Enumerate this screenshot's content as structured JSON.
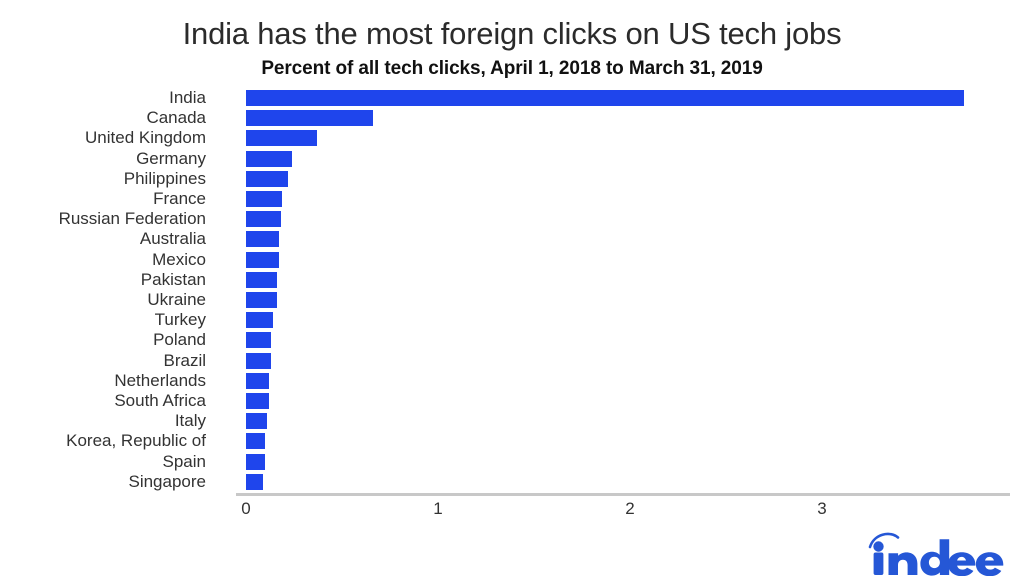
{
  "chart_data": {
    "type": "bar",
    "orientation": "horizontal",
    "title": "India has the most foreign clicks on US tech jobs",
    "subtitle": "Percent of all tech clicks, April 1, 2018 to March 31, 2019",
    "xlabel": "",
    "ylabel": "",
    "xlim": [
      0,
      4.03
    ],
    "xticks": [
      0,
      1,
      2,
      3
    ],
    "xtick_labels": [
      "0",
      "1",
      "2",
      "3"
    ],
    "grid": false,
    "legend": null,
    "bar_color": "#1f45ec",
    "categories": [
      "India",
      "Canada",
      "United Kingdom",
      "Germany",
      "Philippines",
      "France",
      "Russian Federation",
      "Australia",
      "Mexico",
      "Pakistan",
      "Ukraine",
      "Turkey",
      "Poland",
      "Brazil",
      "Netherlands",
      "South Africa",
      "Italy",
      "Korea, Republic of",
      "Spain",
      "Singapore"
    ],
    "values": [
      3.74,
      0.66,
      0.37,
      0.24,
      0.22,
      0.19,
      0.18,
      0.17,
      0.17,
      0.16,
      0.16,
      0.14,
      0.13,
      0.13,
      0.12,
      0.12,
      0.11,
      0.1,
      0.1,
      0.09
    ]
  },
  "branding": {
    "logo_text": "indeed",
    "logo_color": "#2557d6"
  }
}
